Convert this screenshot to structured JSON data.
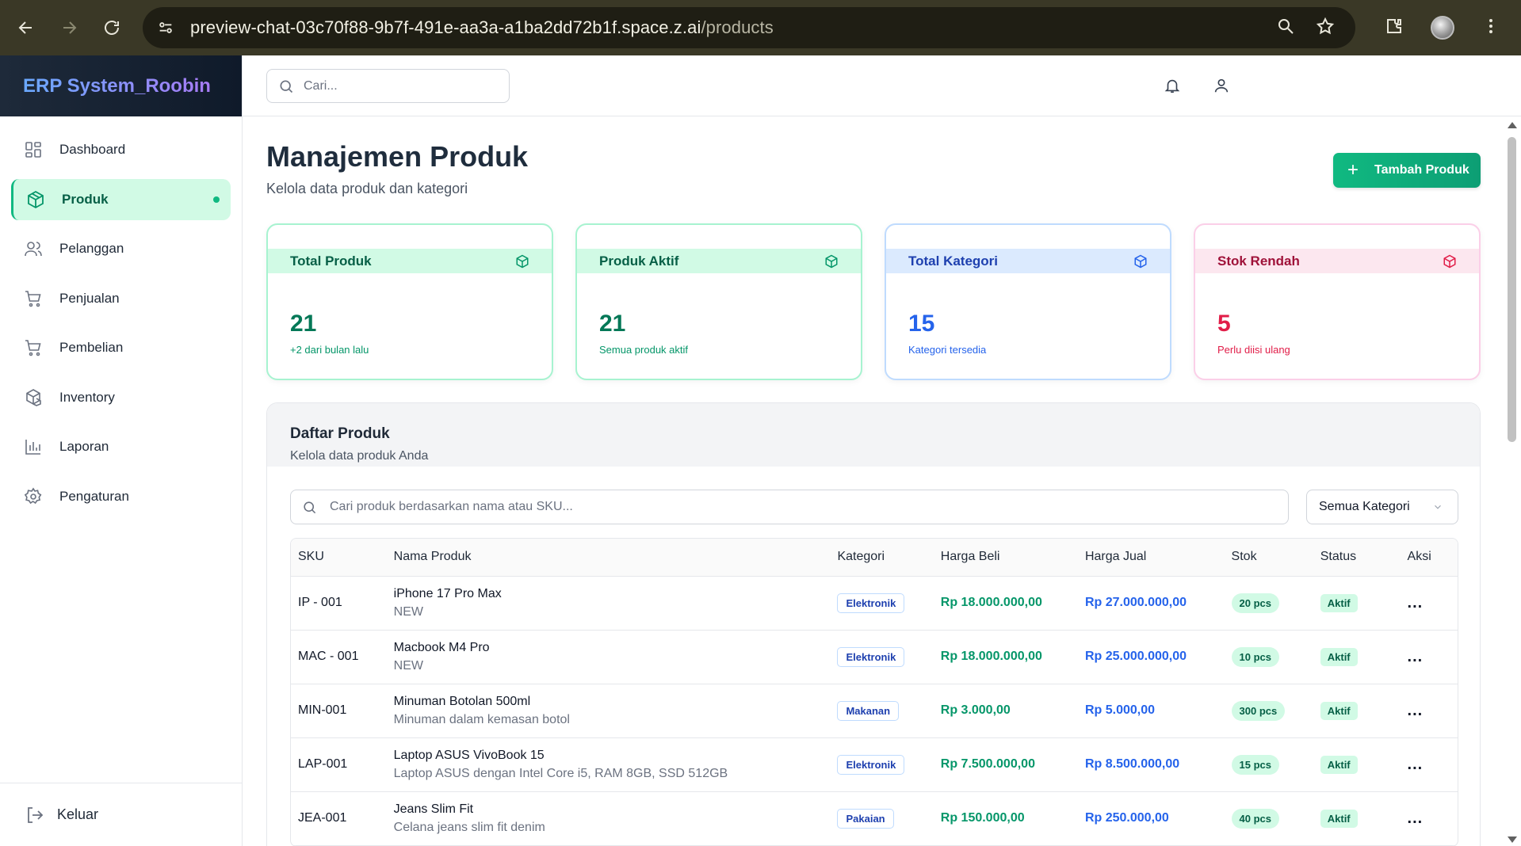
{
  "browser": {
    "url_host": "preview-chat-03c70f88-9b7f-491e-aa3a-a1ba2dd72b1f.space.z.ai",
    "url_path": "/products"
  },
  "sidebar": {
    "brand": "ERP System_Roobin",
    "items": [
      {
        "label": "Dashboard",
        "icon": "dashboard-icon",
        "active": false
      },
      {
        "label": "Produk",
        "icon": "package-icon",
        "active": true
      },
      {
        "label": "Pelanggan",
        "icon": "users-icon",
        "active": false
      },
      {
        "label": "Penjualan",
        "icon": "cart-icon",
        "active": false
      },
      {
        "label": "Pembelian",
        "icon": "cart-icon",
        "active": false
      },
      {
        "label": "Inventory",
        "icon": "boxes-icon",
        "active": false
      },
      {
        "label": "Laporan",
        "icon": "bar-chart-icon",
        "active": false
      },
      {
        "label": "Pengaturan",
        "icon": "gear-icon",
        "active": false
      }
    ],
    "logout": "Keluar"
  },
  "topbar": {
    "search_placeholder": "Cari..."
  },
  "page": {
    "title": "Manajemen Produk",
    "subtitle": "Kelola data produk dan kategori",
    "add_button": "Tambah Produk"
  },
  "cards": [
    {
      "title": "Total Produk",
      "value": "21",
      "note": "+2 dari bulan lalu",
      "color": "#059669"
    },
    {
      "title": "Produk Aktif",
      "value": "21",
      "note": "Semua produk aktif",
      "color": "#059669"
    },
    {
      "title": "Total Kategori",
      "value": "15",
      "note": "Kategori tersedia",
      "color": "#2563eb"
    },
    {
      "title": "Stok Rendah",
      "value": "5",
      "note": "Perlu diisi ulang",
      "color": "#e11d48"
    }
  ],
  "product_list": {
    "title": "Daftar Produk",
    "subtitle": "Kelola data produk Anda",
    "search_placeholder": "Cari produk berdasarkan nama atau SKU...",
    "category_filter": "Semua Kategori",
    "columns": [
      "SKU",
      "Nama Produk",
      "Kategori",
      "Harga Beli",
      "Harga Jual",
      "Stok",
      "Status",
      "Aksi"
    ],
    "rows": [
      {
        "sku": "IP - 001",
        "name": "iPhone 17 Pro Max",
        "desc": "NEW",
        "category": "Elektronik",
        "buy": "Rp 18.000.000,00",
        "sell": "Rp 27.000.000,00",
        "stock": "20 pcs",
        "status": "Aktif"
      },
      {
        "sku": "MAC - 001",
        "name": "Macbook M4 Pro",
        "desc": "NEW",
        "category": "Elektronik",
        "buy": "Rp 18.000.000,00",
        "sell": "Rp 25.000.000,00",
        "stock": "10 pcs",
        "status": "Aktif"
      },
      {
        "sku": "MIN-001",
        "name": "Minuman Botolan 500ml",
        "desc": "Minuman dalam kemasan botol",
        "category": "Makanan",
        "buy": "Rp 3.000,00",
        "sell": "Rp 5.000,00",
        "stock": "300 pcs",
        "status": "Aktif"
      },
      {
        "sku": "LAP-001",
        "name": "Laptop ASUS VivoBook 15",
        "desc": "Laptop ASUS dengan Intel Core i5, RAM 8GB, SSD 512GB",
        "category": "Elektronik",
        "buy": "Rp 7.500.000,00",
        "sell": "Rp 8.500.000,00",
        "stock": "15 pcs",
        "status": "Aktif"
      },
      {
        "sku": "JEA-001",
        "name": "Jeans Slim Fit",
        "desc": "Celana jeans slim fit denim",
        "category": "Pakaian",
        "buy": "Rp 150.000,00",
        "sell": "Rp 250.000,00",
        "stock": "40 pcs",
        "status": "Aktif"
      }
    ],
    "action_label": "..."
  }
}
